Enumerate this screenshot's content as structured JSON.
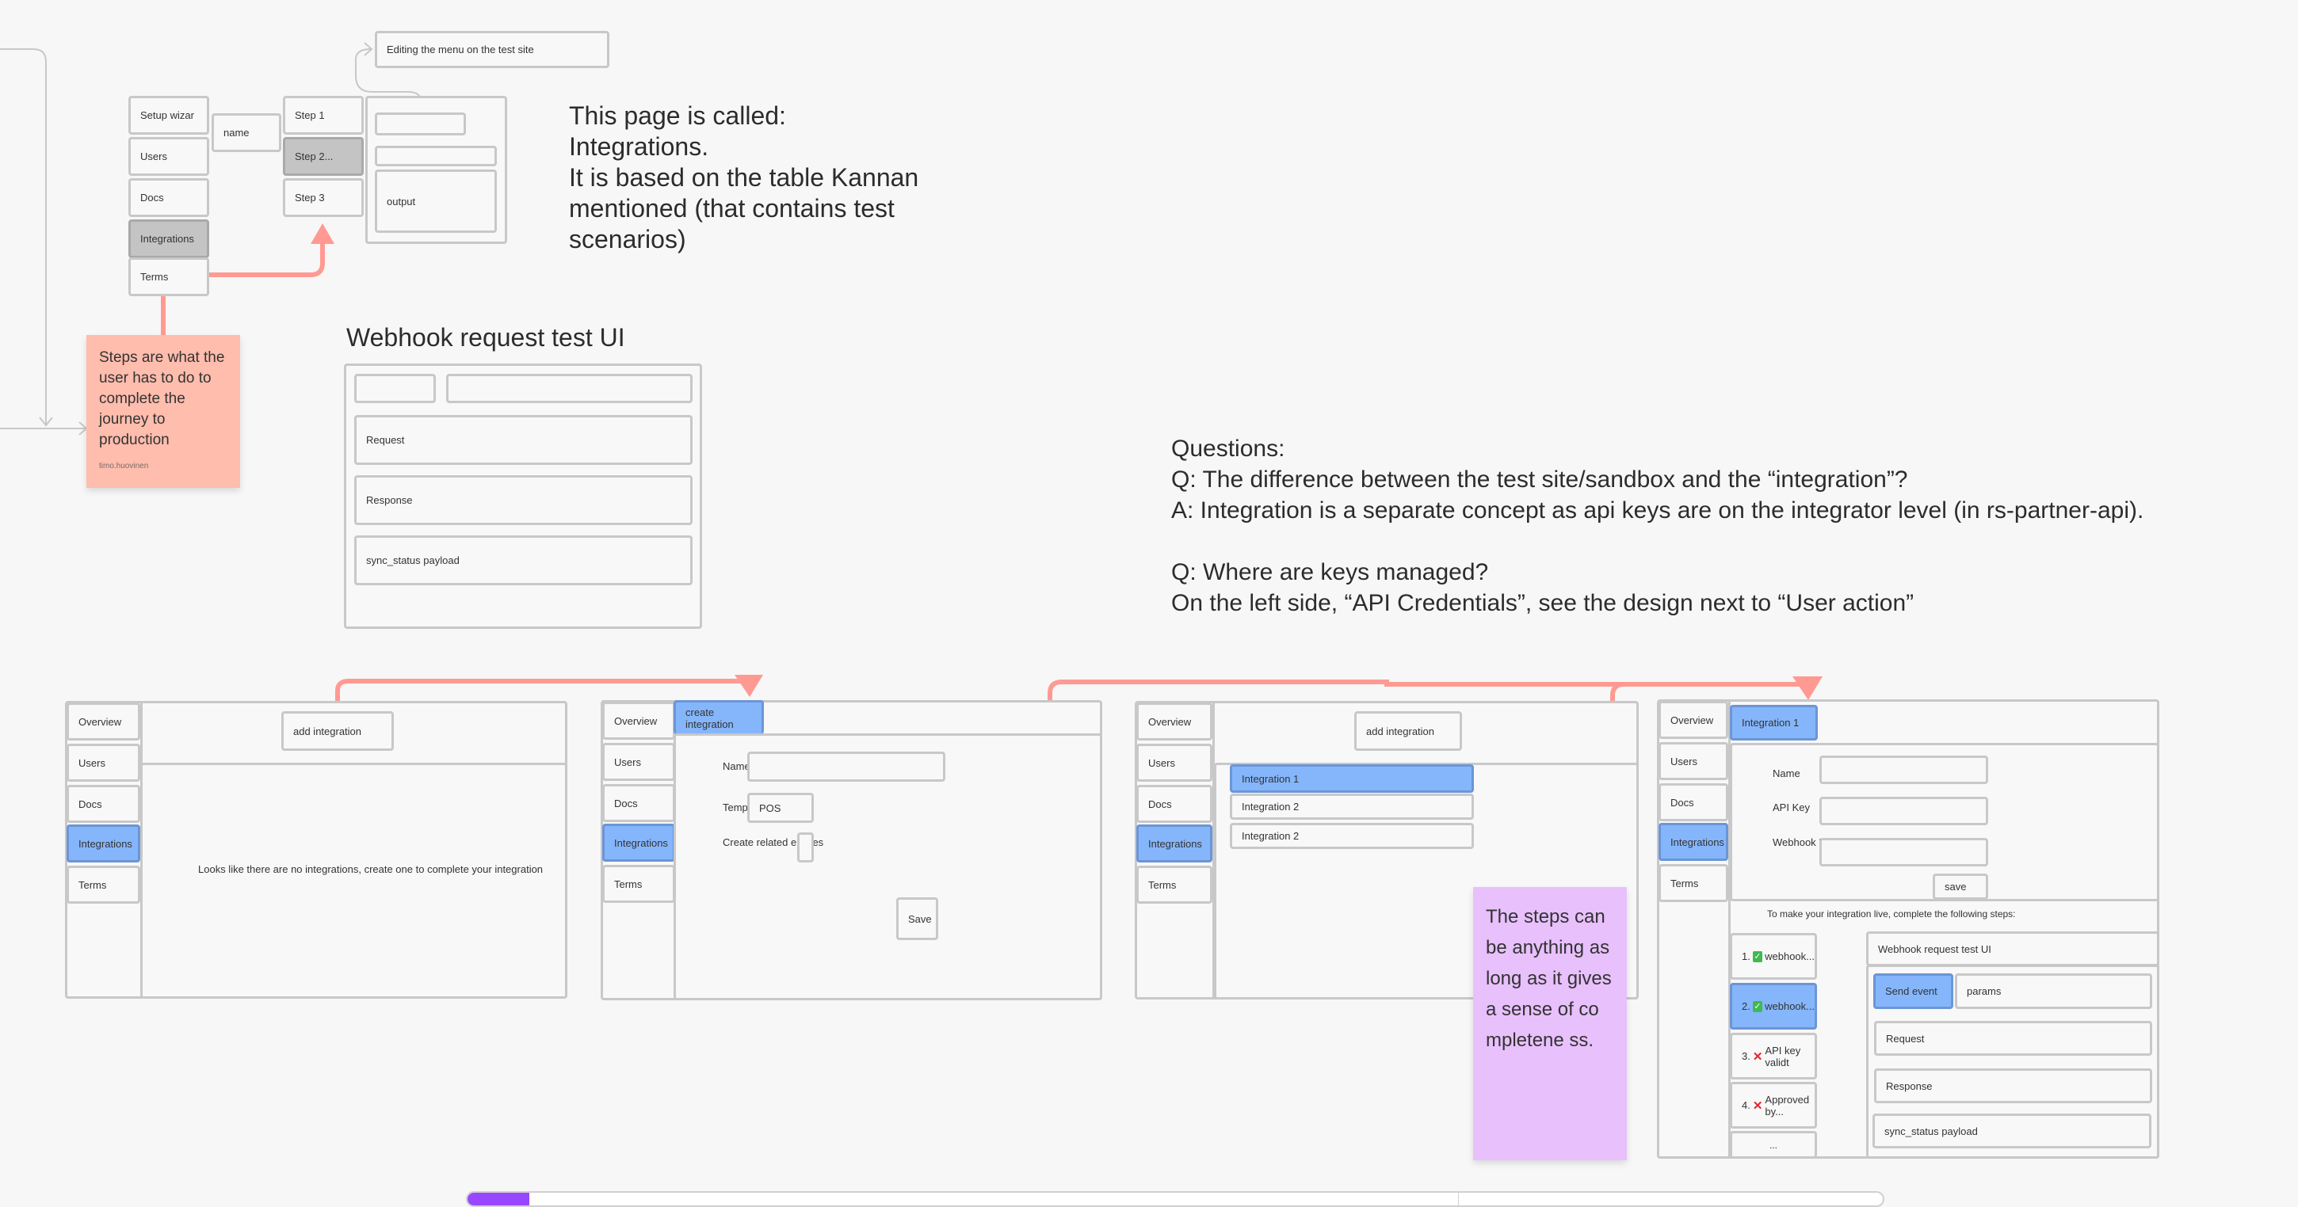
{
  "top_wireframe": {
    "nav_items": [
      "Setup wizar",
      "Users",
      "Docs",
      "Integrations",
      "Terms"
    ],
    "active_nav": "Integrations",
    "name_field": "name",
    "steps": [
      "Step 1",
      "Step 2...",
      "Step 3"
    ],
    "active_step": "Step 2...",
    "output_label": "output",
    "callout": "Editing the menu on the test site"
  },
  "page_note": {
    "lines": "This page is called:\nIntegrations.\nIt is based on the table Kannan\nmentioned (that contains test\nscenarios)"
  },
  "sticky_steps": {
    "text": "Steps are what the user has to do to complete the journey to production",
    "author": "timo.huovinen",
    "color": "#ffbdad"
  },
  "webhook_panel": {
    "title": "Webhook request test UI",
    "fields": [
      "Request",
      "Response",
      "sync_status payload"
    ]
  },
  "questions": {
    "text": "Questions:\nQ: The difference between the test site/sandbox and the “integration”?\nA: Integration is a separate concept as api keys are on the integrator level (in rs-partner-api).\n\nQ: Where are keys managed?\nOn the left side, “API Credentials”, see the design next to “User action”"
  },
  "sidebar": {
    "items": [
      "Overview",
      "Users",
      "Docs",
      "Integrations",
      "Terms"
    ],
    "active": "Integrations"
  },
  "screen1": {
    "add_button": "add integration",
    "empty_message": "Looks like there are no integrations, create one to complete your integration"
  },
  "screen2": {
    "tab": "create integration",
    "name_label": "Name",
    "name_value": "",
    "template_label": "Template",
    "template_value": "POS",
    "related_label": "Create related entities",
    "related_checked": false,
    "save_button": "Save"
  },
  "screen3": {
    "add_button": "add integration",
    "integrations": [
      "Integration 1",
      "Integration 2",
      "Integration 2"
    ],
    "selected": "Integration 1"
  },
  "sticky_completeness": {
    "text": "The steps can be anything as long as it gives a sense of completene ss.",
    "color": "#e8c0fc"
  },
  "screen4": {
    "tab": "Integration 1",
    "name_label": "Name",
    "api_key_label": "API Key",
    "webhook_label": "Webhook URL",
    "save_button": "save",
    "instructions": "To make your integration live, complete the following steps:",
    "steps": [
      {
        "num": "1.",
        "status": "done",
        "label": "webhook..."
      },
      {
        "num": "2.",
        "status": "done",
        "label": "webhook..."
      },
      {
        "num": "3.",
        "status": "failed",
        "label": "API key validt"
      },
      {
        "num": "4.",
        "status": "failed",
        "label": "Approved by..."
      },
      {
        "num": "",
        "status": "",
        "label": "..."
      }
    ],
    "selected_step": 1,
    "detail_title": "Webhook request test UI",
    "send_button": "Send event",
    "params_label": "params",
    "fields": [
      "Request",
      "Response",
      "sync_status payload"
    ]
  },
  "colors": {
    "accent_blue": "#85b6fc",
    "connector_red": "#ff9a92",
    "connector_gray": "#c8c8c8",
    "toolbar_purple": "#9747ff"
  }
}
